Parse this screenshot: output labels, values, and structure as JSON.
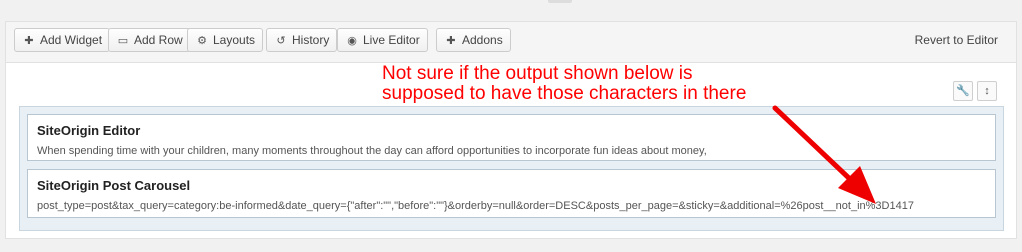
{
  "toolbar": {
    "buttons": [
      {
        "label": "Add Widget",
        "icon": "plus-icon"
      },
      {
        "label": "Add Row",
        "icon": "row-icon"
      },
      {
        "label": "Layouts",
        "icon": "layouts-icon"
      },
      {
        "label": "History",
        "icon": "history-icon"
      },
      {
        "label": "Live Editor",
        "icon": "eye-icon"
      },
      {
        "label": "Addons",
        "icon": "plus-icon"
      }
    ],
    "revert_label": "Revert to Editor"
  },
  "row_tools": {
    "wrench_icon": "wrench-icon",
    "move_icon": "move-icon"
  },
  "widgets": [
    {
      "title": "SiteOrigin Editor",
      "description": "When spending time with your children, many moments throughout the day can afford opportunities to incorporate fun ideas about money,"
    },
    {
      "title": "SiteOrigin Post Carousel",
      "description": "post_type=post&tax_query=category:be-informed&date_query={\"after\":\"\",\"before\":\"\"}&orderby=null&order=DESC&posts_per_page=&sticky=&additional=%26post__not_in%3D1417"
    }
  ],
  "annotation": {
    "line1": "Not sure if the output shown below is",
    "line2": "supposed to have those characters in there",
    "color": "#ff0000"
  }
}
